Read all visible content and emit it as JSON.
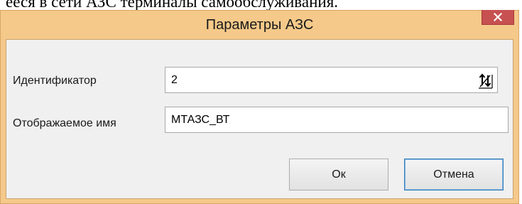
{
  "background": {
    "caption": "ееся в сети АЗС терминалы самообслуживания."
  },
  "window": {
    "title": "Параметры АЗС",
    "close_icon": "close-icon",
    "frame_color": "#f5c98a",
    "close_color": "#c75050"
  },
  "form": {
    "id_label": "Идентификатор",
    "id_value": "2",
    "spin_icon": "spinner-up-down-icon",
    "name_label": "Отображаемое имя",
    "name_value": "МТАЗС_ВТ"
  },
  "buttons": {
    "ok_label": "Ок",
    "cancel_label": "Отмена"
  }
}
